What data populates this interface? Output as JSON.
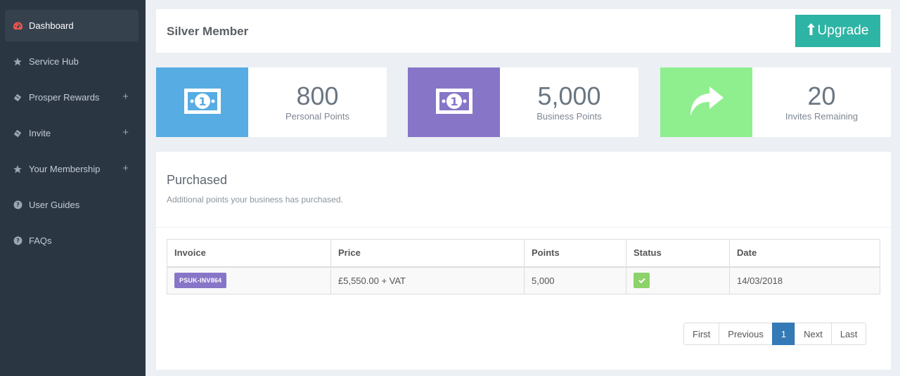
{
  "sidebar": {
    "items": [
      {
        "label": "Dashboard",
        "icon": "dashboard-icon",
        "expandable": false,
        "active": true
      },
      {
        "label": "Service Hub",
        "icon": "star-icon",
        "expandable": false
      },
      {
        "label": "Prosper Rewards",
        "icon": "ticket-icon",
        "expandable": true
      },
      {
        "label": "Invite",
        "icon": "ticket-icon",
        "expandable": true
      },
      {
        "label": "Your Membership",
        "icon": "star-icon",
        "expandable": true
      },
      {
        "label": "User Guides",
        "icon": "question-circle-icon",
        "expandable": false
      },
      {
        "label": "FAQs",
        "icon": "question-circle-icon",
        "expandable": false
      }
    ],
    "plus_symbol": "+"
  },
  "header": {
    "title": "Silver Member",
    "upgrade_label": "Upgrade",
    "upgrade_icon": "arrow-up-icon"
  },
  "stats": [
    {
      "value": "800",
      "label": "Personal Points",
      "color": "#56ace3",
      "icon": "money-icon"
    },
    {
      "value": "5,000",
      "label": "Business Points",
      "color": "#8775c8",
      "icon": "money-icon"
    },
    {
      "value": "20",
      "label": "Invites Remaining",
      "color": "#8fef8f",
      "icon": "share-arrow-icon"
    }
  ],
  "purchased": {
    "title": "Purchased",
    "subtitle": "Additional points your business has purchased.",
    "columns": [
      "Invoice",
      "Price",
      "Points",
      "Status",
      "Date"
    ],
    "rows": [
      {
        "invoice": "PSUK-INV864",
        "price": "£5,550.00 + VAT",
        "points": "5,000",
        "status": "check-icon",
        "date": "14/03/2018"
      }
    ]
  },
  "pagination": {
    "first": "First",
    "previous": "Previous",
    "current": "1",
    "next": "Next",
    "last": "Last"
  },
  "colors": {
    "sidebar_bg": "#2b3643",
    "accent_teal": "#2db4a4",
    "dashboard_icon": "#e9574f",
    "badge_purple": "#8775c8",
    "status_green": "#8bd36a",
    "page_active": "#337ab7"
  }
}
